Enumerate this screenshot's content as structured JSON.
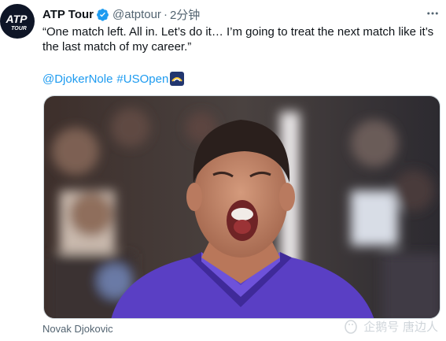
{
  "account": {
    "name": "ATP Tour",
    "handle": "@atptour",
    "separator": "·",
    "time": "2分钟",
    "avatar_text_top": "ATP",
    "avatar_text_bottom": "TOUR",
    "verified_color": "#1d9bf0"
  },
  "tweet": {
    "text": "“One match left. All in. Let’s do it… I’m going to treat the next match like it’s the last match of my career.”",
    "mention": "@DjokerNole",
    "hashtag": "#USOpen"
  },
  "media": {
    "caption": "Novak Djokovic"
  },
  "watermark": {
    "text": "企鹅号 唐边人"
  },
  "colors": {
    "link": "#1d9bf0",
    "secondary_text": "#536471",
    "jersey": "#5a3fc4"
  },
  "icons": {
    "verified": "verified-badge-icon",
    "more": "more-options-icon",
    "usopen": "usopen-flag-icon",
    "watermark": "penguin-logo-icon"
  }
}
